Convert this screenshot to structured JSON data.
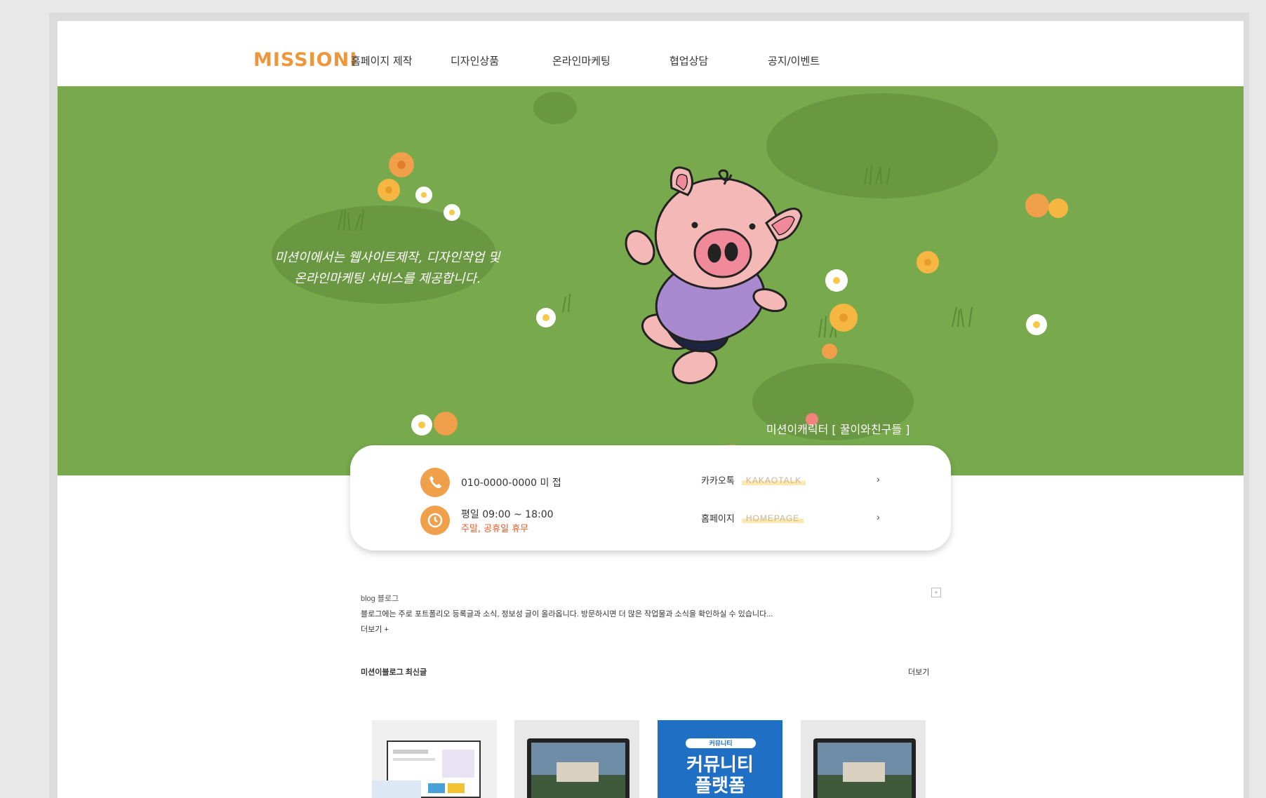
{
  "header": {
    "logo": "MISSIONI",
    "nav": [
      "홈페이지 제작",
      "디자인상품",
      "온라인마케팅",
      "협업상담",
      "공지/이벤트"
    ]
  },
  "hero": {
    "tagline_line1": "미션이에서는 웹사이트제작, 디자인작업 및",
    "tagline_line2": "온라인마케팅 서비스를 제공합니다.",
    "caption": "미션이캐릭터 [ 꿀이와친구들 ]"
  },
  "info": {
    "phone": "010-0000-0000 미 접",
    "hours": "평일 09:00 ~ 18:00",
    "closed": "주말, 공휴일 휴무",
    "kakao_label": "카카오톡",
    "kakao_tag": "KAKAOTALK",
    "home_label": "홈페이지",
    "home_tag": "HOMEPAGE",
    "arrow": "›"
  },
  "blog": {
    "label": "blog 블로그",
    "description": "블로그에는 주로 포트폴리오 등록글과 소식, 정보성 글이 올라옵니다. 방문하시면 더 많은 작업물과 소식을 확인하실 수 있습니다...",
    "more": "더보기 +",
    "expand_icon": "+"
  },
  "posts": {
    "title": "미션이블로그 최신글",
    "more": "더보기",
    "thumb3_badge": "커뮤니티",
    "thumb3_line1": "커뮤니티",
    "thumb3_line2": "플랫폼"
  },
  "colors": {
    "brand_orange": "#f0963a",
    "hero_green": "#78a94c",
    "icon_orange": "#f0a04b"
  }
}
